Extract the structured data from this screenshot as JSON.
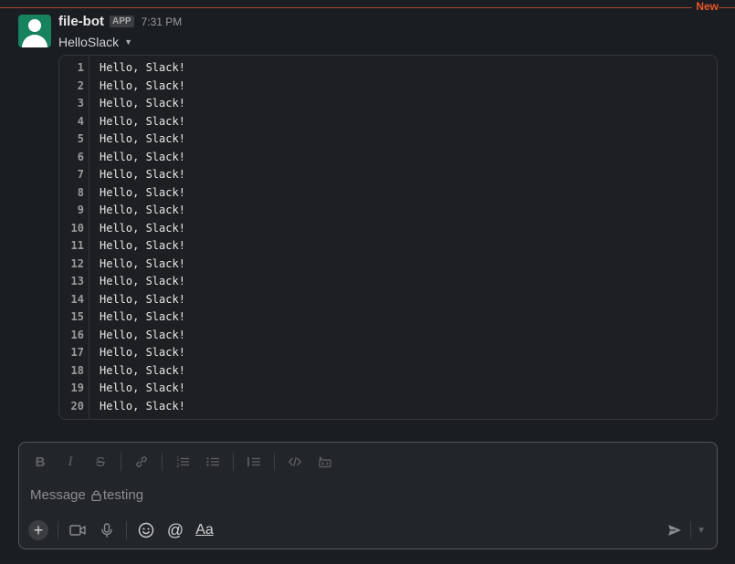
{
  "divider": {
    "new_label": "New"
  },
  "message": {
    "sender": "file-bot",
    "badge": "APP",
    "time": "7:31 PM",
    "file_title": "HelloSlack"
  },
  "code": {
    "lines": [
      {
        "n": "1",
        "text": "Hello, Slack!"
      },
      {
        "n": "2",
        "text": "Hello, Slack!"
      },
      {
        "n": "3",
        "text": "Hello, Slack!"
      },
      {
        "n": "4",
        "text": "Hello, Slack!"
      },
      {
        "n": "5",
        "text": "Hello, Slack!"
      },
      {
        "n": "6",
        "text": "Hello, Slack!"
      },
      {
        "n": "7",
        "text": "Hello, Slack!"
      },
      {
        "n": "8",
        "text": "Hello, Slack!"
      },
      {
        "n": "9",
        "text": "Hello, Slack!"
      },
      {
        "n": "10",
        "text": "Hello, Slack!"
      },
      {
        "n": "11",
        "text": "Hello, Slack!"
      },
      {
        "n": "12",
        "text": "Hello, Slack!"
      },
      {
        "n": "13",
        "text": "Hello, Slack!"
      },
      {
        "n": "14",
        "text": "Hello, Slack!"
      },
      {
        "n": "15",
        "text": "Hello, Slack!"
      },
      {
        "n": "16",
        "text": "Hello, Slack!"
      },
      {
        "n": "17",
        "text": "Hello, Slack!"
      },
      {
        "n": "18",
        "text": "Hello, Slack!"
      },
      {
        "n": "19",
        "text": "Hello, Slack!"
      },
      {
        "n": "20",
        "text": "Hello, Slack!"
      }
    ]
  },
  "composer": {
    "placeholder_prefix": "Message",
    "channel": "testing",
    "format_label": "Aa",
    "toolbar_icons": [
      "bold-icon",
      "italic-icon",
      "strikethrough-icon",
      "link-icon",
      "ordered-list-icon",
      "bulleted-list-icon",
      "blockquote-icon",
      "code-icon",
      "code-block-icon"
    ],
    "bottom_icons": [
      "plus-icon",
      "video-icon",
      "microphone-icon",
      "emoji-icon",
      "mention-icon",
      "formatting-icon",
      "send-icon",
      "chevron-down-icon"
    ]
  },
  "colors": {
    "background": "#1a1d21",
    "new_divider": "#a54532",
    "new_label": "#e8562a",
    "avatar": "#17835e"
  }
}
